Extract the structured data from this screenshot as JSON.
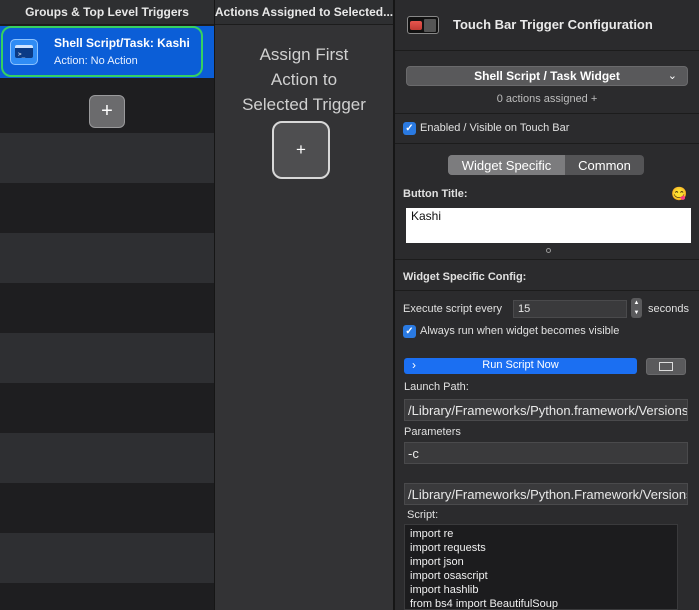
{
  "left": {
    "header": "Groups & Top Level Triggers",
    "trigger_title": "Shell Script/Task: Kashi",
    "trigger_subtitle": "Action: No Action",
    "add_symbol": "+"
  },
  "middle": {
    "header": "Actions Assigned to Selected...",
    "assign_line1": "Assign First",
    "assign_line2": "Action to",
    "assign_line3": "Selected Trigger",
    "add_symbol": "+"
  },
  "right": {
    "title": "Touch Bar Trigger Configuration",
    "widget_select": "Shell Script / Task Widget",
    "actions_assigned": "0 actions assigned +",
    "enabled_label": "Enabled / Visible on Touch Bar",
    "tab_widget_specific": "Widget Specific",
    "tab_common": "Common",
    "button_title_label": "Button Title:",
    "button_title_value": "Kashi",
    "emoji": "😋",
    "widget_config_label": "Widget Specific Config:",
    "execute_every_label": "Execute script every",
    "execute_every_value": "15",
    "seconds_label": "seconds",
    "always_run_label": "Always run when widget becomes visible",
    "run_now_label": "Run Script Now",
    "launch_path_label": "Launch Path:",
    "launch_path_value": "/Library/Frameworks/Python.framework/Versions",
    "parameters_label": "Parameters",
    "parameters_value": "-c",
    "path2_value": "/Library/Frameworks/Python.Framework/Versions",
    "script_label": "Script:",
    "script_lines": [
      "import re",
      "import requests",
      "import json",
      "import osascript",
      "import hashlib",
      "from bs4 import BeautifulSoup"
    ]
  }
}
